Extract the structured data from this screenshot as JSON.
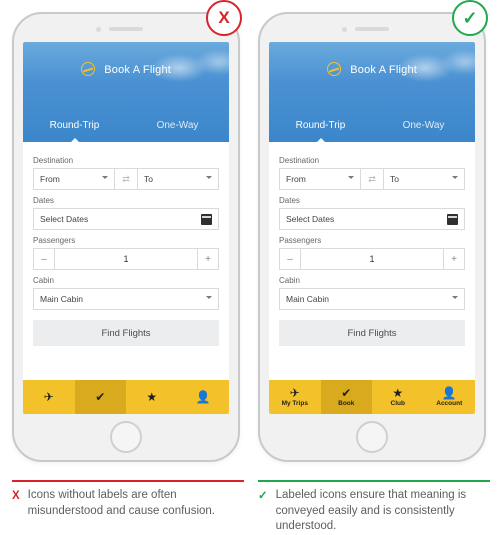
{
  "badges": {
    "bad": "X",
    "good": "✓"
  },
  "header": {
    "title": "Book A Flight",
    "tabs": [
      "Round-Trip",
      "One-Way"
    ],
    "active_tab_index": 0
  },
  "form": {
    "destination_label": "Destination",
    "from_placeholder": "From",
    "to_placeholder": "To",
    "swap_glyph": "⇄",
    "dates_label": "Dates",
    "dates_placeholder": "Select Dates",
    "passengers_label": "Passengers",
    "minus_glyph": "–",
    "passengers_value": "1",
    "plus_glyph": "+",
    "cabin_label": "Cabin",
    "cabin_value": "Main Cabin",
    "cta_label": "Find Flights"
  },
  "nav_icons": {
    "my_trips": "✈",
    "book": "✔",
    "club": "★",
    "account": "👤"
  },
  "nav_labels": {
    "my_trips": "My Trips",
    "book": "Book",
    "club": "Club",
    "account": "Account"
  },
  "captions": {
    "bad_mark": "X",
    "bad_text": "Icons without labels are often misunderstood and cause confusion.",
    "good_mark": "✓",
    "good_text": "Labeled icons ensure that meaning is conveyed easily and is consistently understood."
  },
  "colors": {
    "accent_yellow": "#f3c22a",
    "header_blue": "#3b86cb",
    "error_red": "#d8232a",
    "success_green": "#1fa94b"
  }
}
